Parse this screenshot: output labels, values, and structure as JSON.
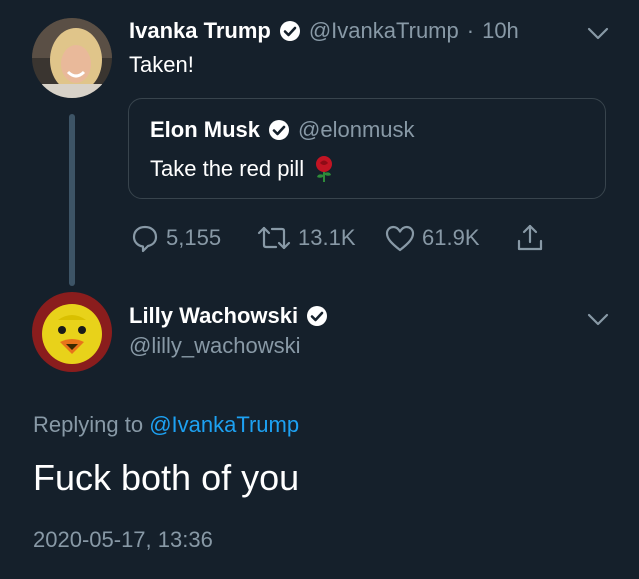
{
  "original_tweet": {
    "author_name": "Ivanka Trump",
    "author_handle": "@IvankaTrump",
    "separator": "·",
    "time_ago": "10h",
    "text": "Taken!",
    "quoted_tweet": {
      "author_name": "Elon Musk",
      "author_handle": "@elonmusk",
      "text": "Take the red pill",
      "emoji": "🌹"
    },
    "stats": {
      "replies": "5,155",
      "retweets": "13.1K",
      "likes": "61.9K"
    }
  },
  "reply_tweet": {
    "author_name": "Lilly Wachowski",
    "author_handle": "@lilly_wachowski",
    "replying_to_prefix": "Replying to",
    "replying_to_handle": "@IvankaTrump",
    "text": "Fuck both of you",
    "timestamp": "2020-05-17, 13:36"
  },
  "colors": {
    "background": "#15202b",
    "text": "#ffffff",
    "muted": "#8899a6",
    "accent": "#1da1f2",
    "border": "#38444d",
    "thread_line": "#3d5466"
  },
  "icons": {
    "verified": "verified-badge-icon",
    "more": "chevron-down-icon",
    "reply": "reply-bubble-icon",
    "retweet": "retweet-icon",
    "like": "heart-icon",
    "share": "share-icon"
  }
}
